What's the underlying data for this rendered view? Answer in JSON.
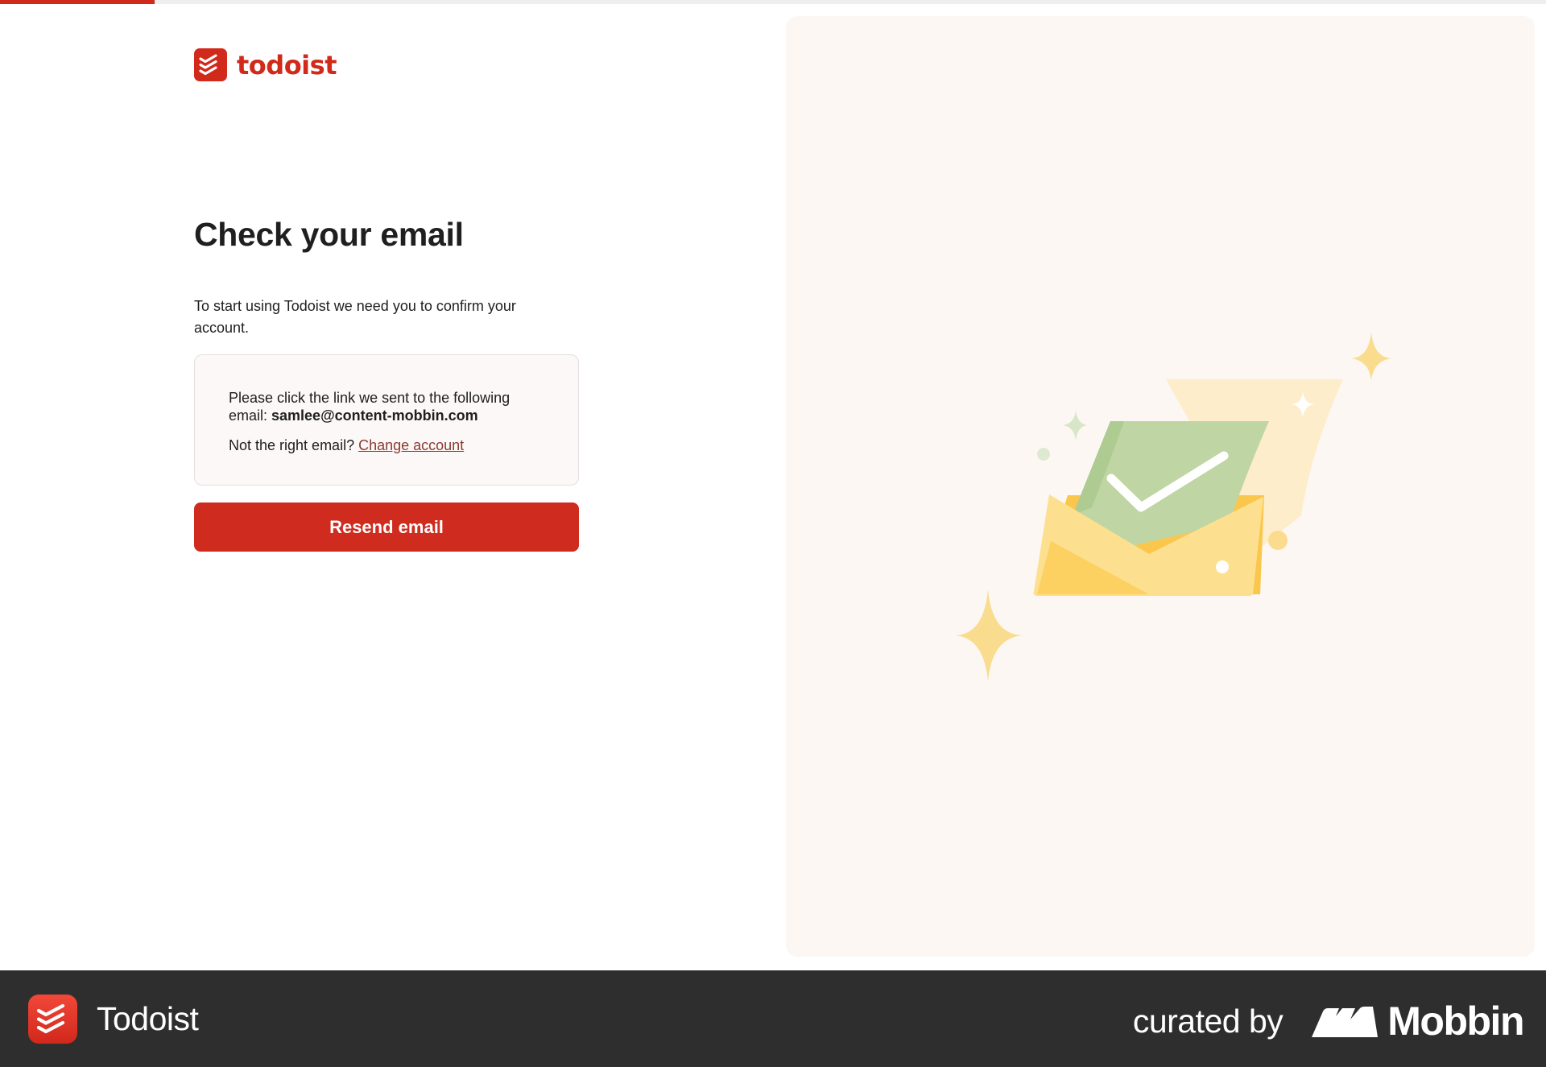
{
  "progress": {
    "fraction": 0.1
  },
  "brand": {
    "logo_icon": "todoist-logo-icon",
    "name": "todoist",
    "color": "#d1291a"
  },
  "main": {
    "title": "Check your email",
    "intro": "To start using Todoist we need you to confirm your account.",
    "info": {
      "line_prefix": "Please click the link we sent to the following email: ",
      "email": "samlee@content-mobbin.com",
      "wrong_prefix": "Not the right email? ",
      "change_label": "Change account"
    },
    "resend_label": "Resend email"
  },
  "illustration": {
    "icon": "envelope-checkmark-illustration"
  },
  "footer": {
    "app_icon": "todoist-app-icon",
    "app_name": "Todoist",
    "curated_label": "curated by",
    "mobbin_icon": "mobbin-logo-icon",
    "mobbin_label": "Mobbin",
    "background": "#2e2e2e"
  }
}
